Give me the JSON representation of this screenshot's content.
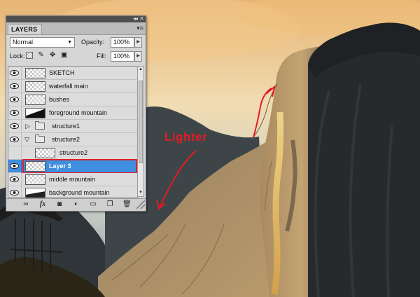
{
  "canvas": {
    "annotation": {
      "text": "Lighter",
      "color": "#e31b23"
    }
  },
  "layers_panel": {
    "tab_label": "LAYERS",
    "blend_mode": "Normal",
    "opacity_label": "Opacity:",
    "opacity_value": "100%",
    "lock_label": "Lock:",
    "fill_label": "Fill:",
    "fill_value": "100%",
    "selection_color": "#3f8fe0",
    "highlight_color": "#e0202a",
    "layers": [
      {
        "name": "SKETCH",
        "kind": "layer",
        "visible": true
      },
      {
        "name": "waterfall main",
        "kind": "layer",
        "visible": true
      },
      {
        "name": "bushes",
        "kind": "layer",
        "visible": true
      },
      {
        "name": "foreground mountain",
        "kind": "layer",
        "visible": true
      },
      {
        "name": "structure1",
        "kind": "group",
        "expanded": false,
        "visible": true
      },
      {
        "name": "structure2",
        "kind": "group",
        "expanded": true,
        "visible": true
      },
      {
        "name": "structure2",
        "kind": "layer",
        "indent": true,
        "visible": true
      },
      {
        "name": "Layer 3",
        "kind": "layer",
        "visible": true,
        "selected": true,
        "highlighted": true
      },
      {
        "name": "middle mountain",
        "kind": "layer",
        "visible": true
      },
      {
        "name": "background mountain",
        "kind": "layer",
        "visible": true
      }
    ],
    "footer_icons": [
      "link-layers-icon",
      "fx-icon",
      "layer-mask-icon",
      "adjustment-layer-icon",
      "new-group-icon",
      "new-layer-icon",
      "trash-icon"
    ]
  }
}
